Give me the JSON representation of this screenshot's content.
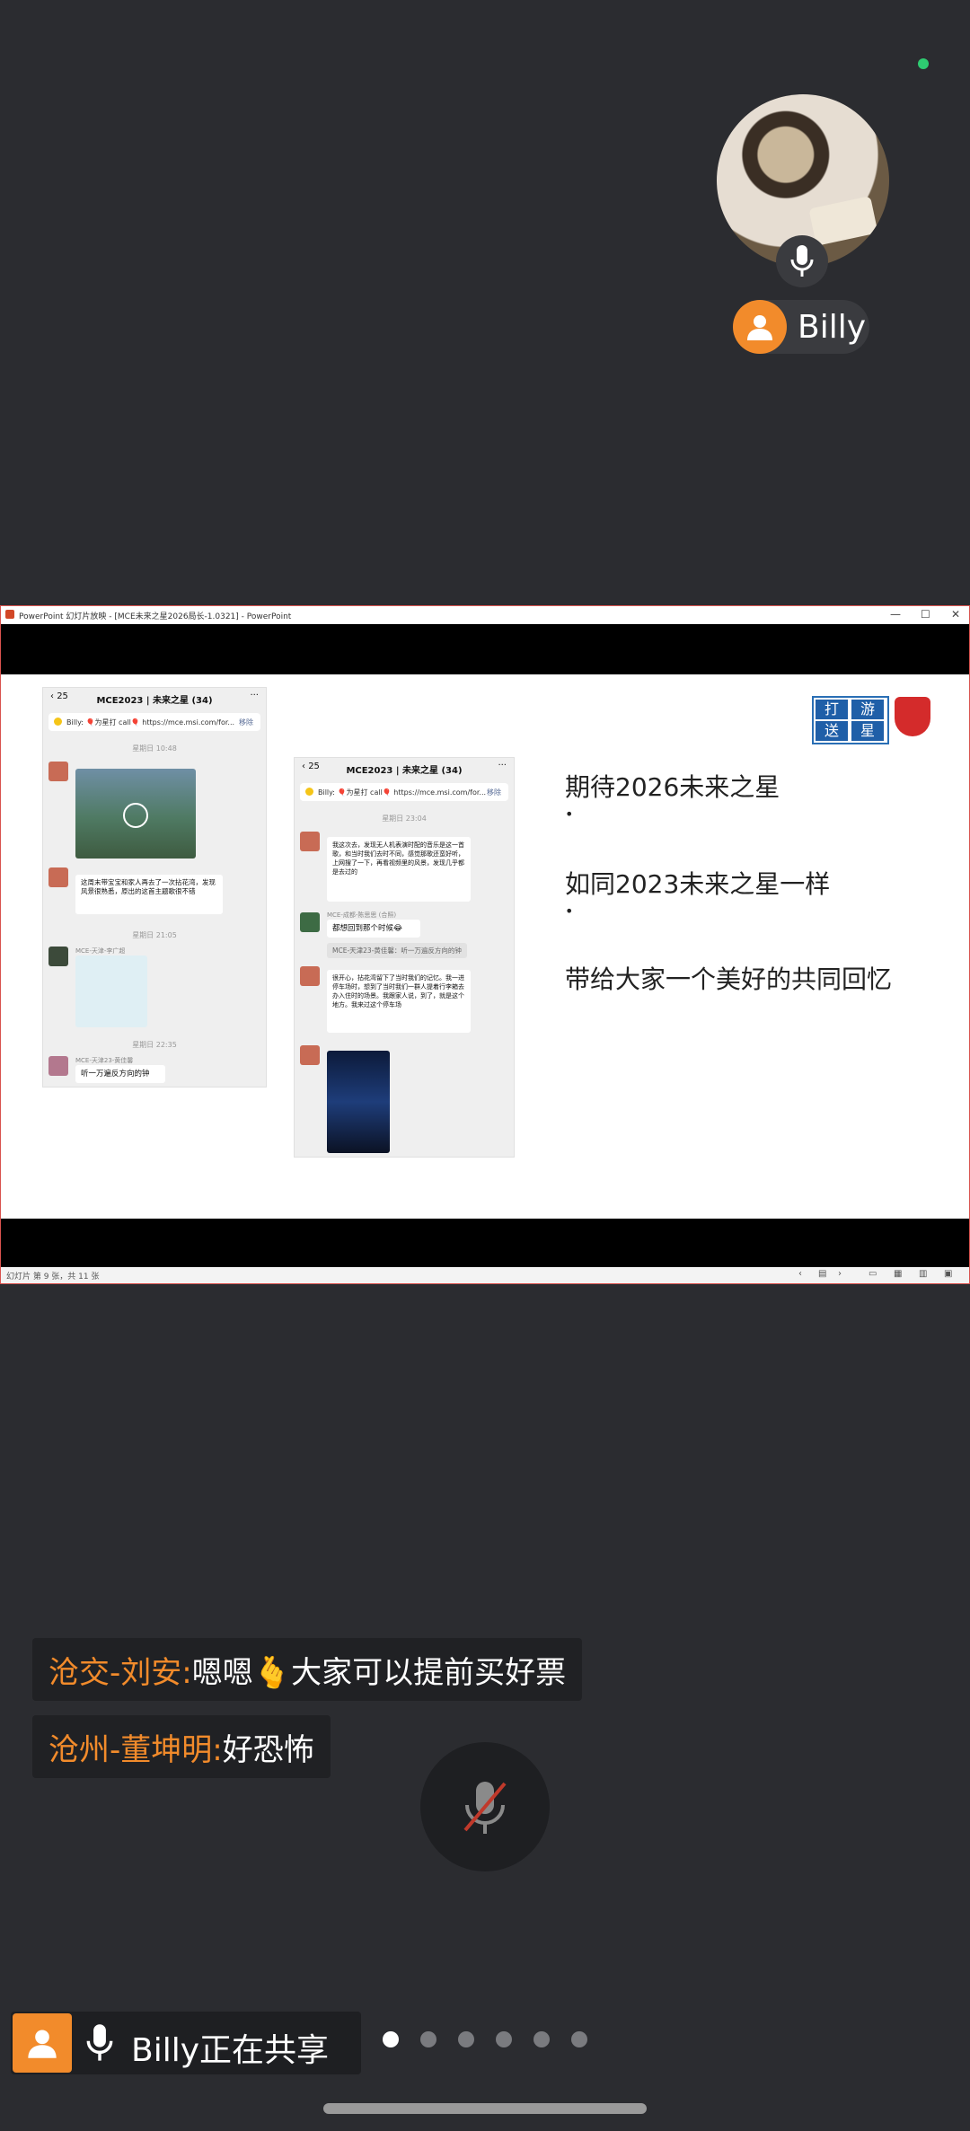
{
  "presenter": {
    "name": "Billy",
    "status": "online",
    "status_color": "#2ecc71",
    "avatar_color": "#f28b2b",
    "mic_icon": "mic-icon"
  },
  "window": {
    "title": "PowerPoint 幻灯片放映 - [MCE未来之星2026局长-1.0321] - PowerPoint",
    "controls": [
      "—",
      "☐",
      "✕"
    ],
    "status_text": "幻灯片 第 9 张，共 11 张"
  },
  "slide": {
    "lines": [
      "期待2026未来之星",
      "如同2023未来之星一样",
      "带给大家一个美好的共同回忆"
    ],
    "bullet": "•",
    "logo_text": [
      "打",
      "游",
      "送",
      "星"
    ],
    "left_phone": {
      "back_count": "25",
      "title": "MCE2023 | 未来之星 (34)",
      "pinned": "Billy: 🎈为星打 call🎈 https://mce.msi.com/for...",
      "remove": "移除",
      "time1": "星期日 10:48",
      "caption": "这周末带宝宝和家人再去了一次拈花湾，发现风景很熟悉，原出的这首主题歌很不错",
      "time2": "星期日 21:05",
      "sender_sticker": "MCE-天津-李广超",
      "time3": "星期日 22:35",
      "sender_last": "MCE-天津23-黄佳馨",
      "last_msg": "听一万遍反方向的钟"
    },
    "right_phone": {
      "back_count": "25",
      "title": "MCE2023 | 未来之星 (34)",
      "pinned": "Billy: 🎈为星打 call🎈 https://mce.msi.com/for...",
      "remove": "移除",
      "time1": "星期日 23:04",
      "msg1": "我这次去，发现无人机表演时配的音乐是这一首歌，和当时我们去时不同，感觉那歌还蛮好听，上网搜了一下，再看视频里的风景，发现几乎都是去过的",
      "sender2": "MCE-成都-陈思思 (合照)",
      "msg2": "都想回到那个时候😂",
      "sys_msg": "MCE-天津23-黄佳馨：听一万遍反方向的钟",
      "msg3": "很开心，拈花湾留下了当时我们的记忆。我一进停车场时，想到了当时我们一群人提着行李箱去办入住时的场景。我跟家人说，到了，就是这个地方。我来过这个停车场"
    }
  },
  "chat": [
    {
      "who": "沧交-刘安:",
      "msg": "嗯嗯🫰大家可以提前买好票"
    },
    {
      "who": "沧州-董坤明:",
      "msg": "好恐怖"
    }
  ],
  "mic_state": "muted",
  "bottom": {
    "share_label": "Billy正在共享",
    "page_dots": 6,
    "active_dot": 0
  },
  "colors": {
    "background": "#2b2c30",
    "accent": "#f28b2b",
    "chat_name": "#f28b2b"
  }
}
